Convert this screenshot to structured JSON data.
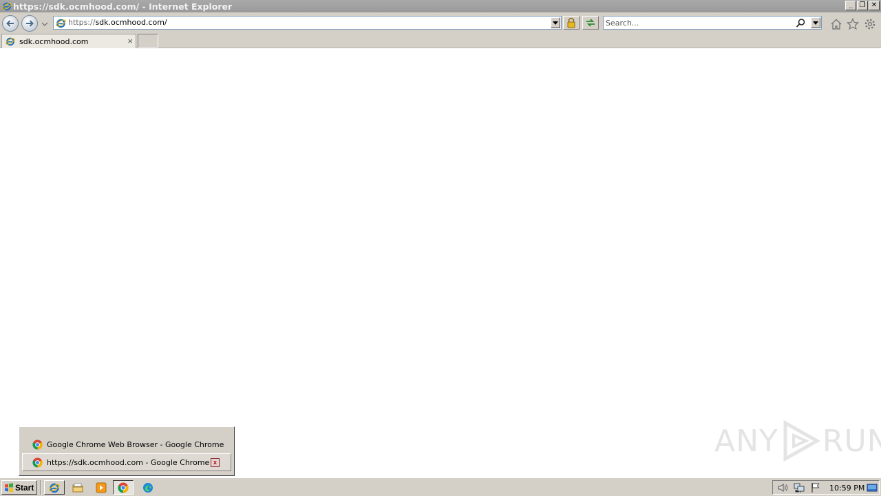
{
  "window": {
    "title": "https://sdk.ocmhood.com/ - Internet Explorer",
    "minimize_label": "_",
    "restore_label": "❐",
    "close_label": "✕"
  },
  "address_bar": {
    "url_prefix": "https://",
    "url_rest": "sdk.ocmhood.com/"
  },
  "search": {
    "placeholder": "Search..."
  },
  "tabs": [
    {
      "label": "sdk.ocmhood.com",
      "close_label": "×"
    }
  ],
  "chrome_popup": {
    "items": [
      {
        "label": "Google Chrome Web Browser - Google Chrome"
      },
      {
        "label": "https://sdk.ocmhood.com - Google Chrome"
      }
    ],
    "close_label": "x"
  },
  "watermark": {
    "left": "ANY",
    "right": "RUN"
  },
  "taskbar": {
    "start_label": "Start",
    "clock": "10:59 PM"
  },
  "colors": {
    "titlebar": "#9e9e9e",
    "chrome_face": "#d4d0c8",
    "ie_blue": "#1e73be"
  },
  "icons": [
    "ie-icon",
    "back-icon",
    "forward-icon",
    "lock-icon",
    "refresh-icon",
    "search-icon",
    "home-icon",
    "star-icon",
    "gear-icon",
    "chrome-icon",
    "folder-icon",
    "media-player-icon",
    "edge-icon",
    "speaker-icon",
    "network-icon",
    "flag-icon",
    "desktop-icon"
  ]
}
